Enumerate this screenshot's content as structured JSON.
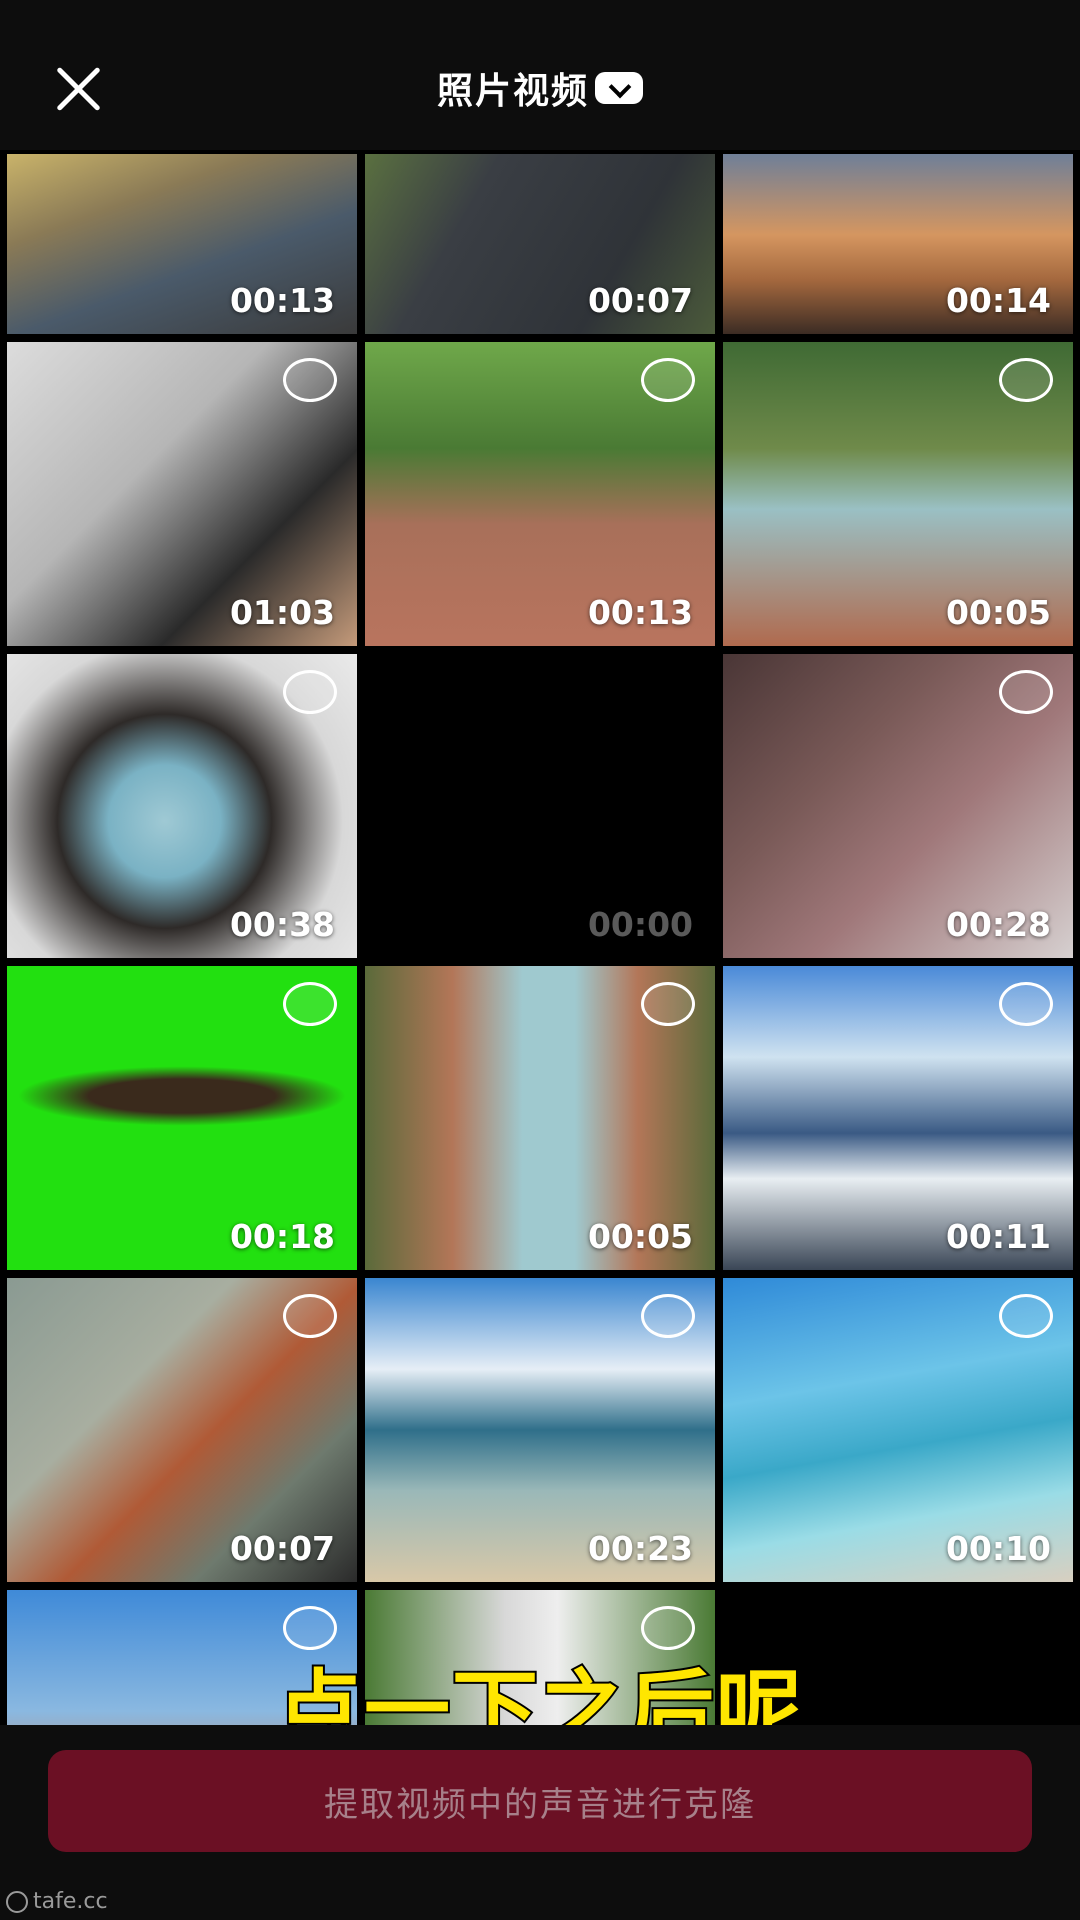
{
  "header": {
    "title": "照片视频"
  },
  "grid": {
    "cells": [
      {
        "duration": "00:13",
        "selectable": false
      },
      {
        "duration": "00:07",
        "selectable": false
      },
      {
        "duration": "00:14",
        "selectable": false
      },
      {
        "duration": "01:03",
        "selectable": true
      },
      {
        "duration": "00:13",
        "selectable": true
      },
      {
        "duration": "00:05",
        "selectable": true
      },
      {
        "duration": "00:38",
        "selectable": true
      },
      {
        "duration": "00:00",
        "selectable": false
      },
      {
        "duration": "00:28",
        "selectable": true
      },
      {
        "duration": "00:18",
        "selectable": true
      },
      {
        "duration": "00:05",
        "selectable": true
      },
      {
        "duration": "00:11",
        "selectable": true
      },
      {
        "duration": "00:07",
        "selectable": true
      },
      {
        "duration": "00:23",
        "selectable": true
      },
      {
        "duration": "00:10",
        "selectable": true
      },
      {
        "duration": "",
        "selectable": true
      },
      {
        "duration": "",
        "selectable": true
      }
    ]
  },
  "caption": "点一下之后呢",
  "cta_label": "提取视频中的声音进行克隆",
  "watermark": "tafe.cc"
}
